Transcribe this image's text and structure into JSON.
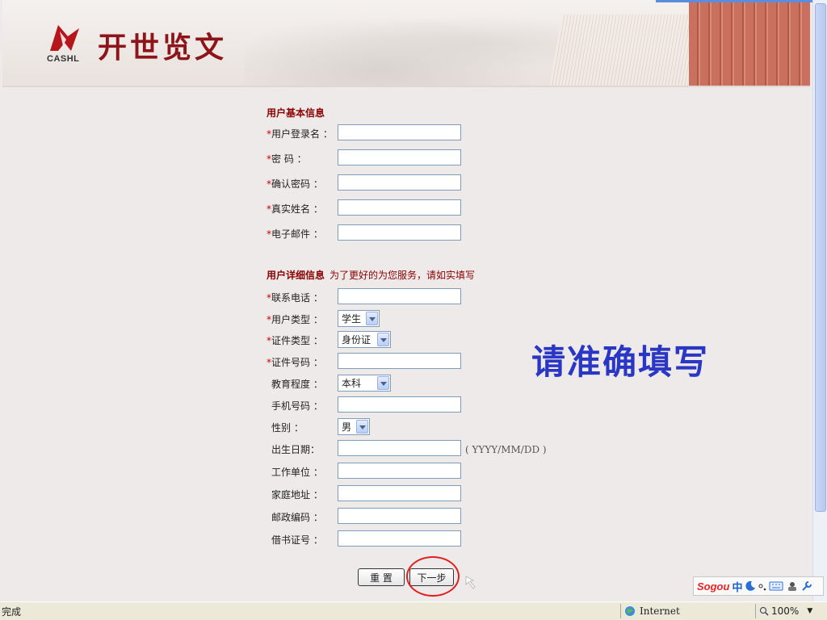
{
  "header": {
    "logo_cashl": "CASHL",
    "logo_text": "开世览文"
  },
  "basic": {
    "title": "用户基本信息",
    "fields": [
      {
        "required": "*",
        "label": "用户登录名 ：",
        "value": ""
      },
      {
        "required": "*",
        "label": "密  码 ：",
        "value": ""
      },
      {
        "required": "*",
        "label": "确认密码 ：",
        "value": ""
      },
      {
        "required": "*",
        "label": "真实姓名 ：",
        "value": ""
      },
      {
        "required": "*",
        "label": "电子邮件 ：",
        "value": ""
      }
    ]
  },
  "detail": {
    "title": "用户详细信息",
    "note": "为了更好的为您服务，请如实填写",
    "phone": {
      "required": "*",
      "label": "联系电话 ："
    },
    "user_type": {
      "required": "*",
      "label": "用户类型 ：",
      "selected": "学生"
    },
    "id_type": {
      "required": "*",
      "label": "证件类型 ：",
      "selected": "身份证"
    },
    "id_number": {
      "required": "*",
      "label": "证件号码 ："
    },
    "education": {
      "label": "教育程度 ：",
      "selected": "本科"
    },
    "mobile": {
      "label": "手机号码 ："
    },
    "gender": {
      "label": "性别 ：",
      "selected": "男"
    },
    "birthday": {
      "label": "出生日期：",
      "hint": "( YYYY/MM/DD )"
    },
    "employer": {
      "label": "工作单位 ："
    },
    "address": {
      "label": "家庭地址 ："
    },
    "postcode": {
      "label": "邮政编码 ："
    },
    "library_card": {
      "label": "借书证号 ："
    }
  },
  "annotation": "请准确填写",
  "buttons": {
    "reset": "重  置",
    "next": "下一步"
  },
  "ime": {
    "brand": "Sogou",
    "mode": "中"
  },
  "statusbar": {
    "status": "完成",
    "zone": "Internet",
    "zoom": "100%"
  },
  "colors": {
    "accent": "#8b0000",
    "annotation": "#2a36c4",
    "circle": "#e02020"
  }
}
